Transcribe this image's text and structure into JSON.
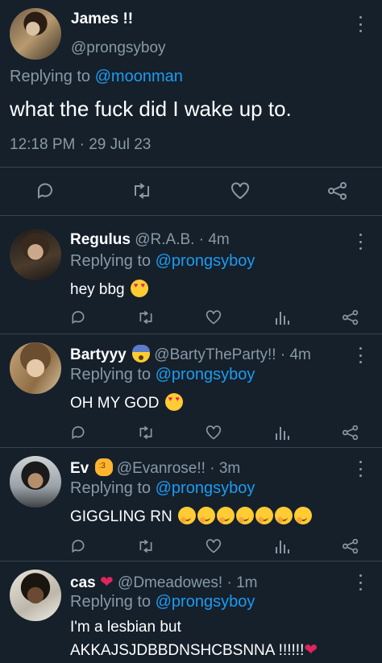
{
  "main_tweet": {
    "name": "James !!",
    "handle": "@prongsyboy",
    "replying_prefix": "Replying to",
    "replying_handle": "@moonman",
    "text": "what the fuck did I wake up to.",
    "timestamp": "12:18 PM · 29 Jul 23",
    "actions": [
      "reply-icon",
      "retweet-icon",
      "like-icon",
      "share-icon"
    ]
  },
  "replies": [
    {
      "name": "Regulus",
      "handle": "@R.A.B.",
      "time": " · 4m",
      "replying_prefix": "Replying to",
      "replying_handle": "@prongsyboy",
      "text": "hey bbg",
      "emoji": "smiling-face-with-heart-eyes-icon"
    },
    {
      "name": "Bartyyy",
      "name_emoji": "face-screaming-in-fear-icon",
      "handle": "@BartyTheParty!!",
      "time": " · 4m",
      "replying_prefix": "Replying to",
      "replying_handle": "@prongsyboy",
      "text": "OH MY GOD",
      "emoji": "smiling-face-with-heart-eyes-icon"
    },
    {
      "name": "Ev",
      "name_emoji": "cat-face-icon",
      "handle": "@Evanrose!!",
      "time": " · 3m",
      "replying_prefix": "Replying to",
      "replying_handle": "@prongsyboy",
      "text": "GIGGLING RN",
      "emoji": "face-with-hand-over-mouth-icon",
      "emoji_count": 7
    },
    {
      "name": "cas",
      "name_emoji": "red-heart-icon",
      "handle": "@Dmeadowes!",
      "time": " · 1m",
      "replying_prefix": "Replying to",
      "replying_handle": "@prongsyboy",
      "text_line1": "I'm a lesbian but",
      "text_line2": "AKKAJSJDBBDNSHCBSNNA !!!!!!",
      "text_line2_emoji": "red-heart-icon"
    }
  ],
  "reply_actions": [
    "reply-icon",
    "retweet-icon",
    "like-icon",
    "views-icon",
    "share-icon"
  ],
  "colors": {
    "background": "#15202b",
    "text": "#ffffff",
    "muted": "#8899a6",
    "link": "#1d9bf0",
    "divider": "#38444d"
  }
}
